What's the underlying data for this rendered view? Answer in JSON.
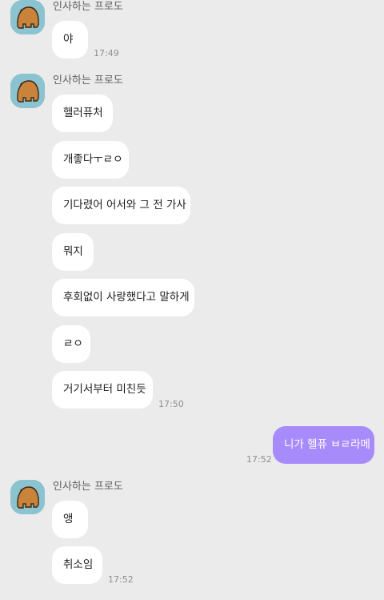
{
  "chat": {
    "groups": [
      {
        "sender": "인사하는 프로도",
        "messages": [
          {
            "text": "야",
            "time": "17:49"
          }
        ]
      },
      {
        "sender": "인사하는 프로도",
        "messages": [
          {
            "text": "헬러퓨처"
          },
          {
            "text": "개좋다ㅜㄹㅇ"
          },
          {
            "text": "기다렸어 어서와 그 전 가사"
          },
          {
            "text": "뭐지"
          },
          {
            "text": "후회없이 사랑했다고 말하게"
          },
          {
            "text": "ㄹㅇ"
          },
          {
            "text": "거기서부터 미친듯",
            "time": "17:50"
          }
        ]
      },
      {
        "sender": "",
        "outgoing": true,
        "messages": [
          {
            "text": "니가 헬퓨 ㅂㄹ라메",
            "time": "17:52"
          }
        ]
      },
      {
        "sender": "인사하는 프로도",
        "messages": [
          {
            "text": "앵"
          },
          {
            "text": "취소임",
            "time": "17:52"
          }
        ]
      }
    ]
  },
  "colors": {
    "background": "#ebebeb",
    "bubble_in": "#ffffff",
    "bubble_out": "#a78bfa",
    "avatar_bg": "#8cc3d0"
  },
  "icons": {
    "avatar": "bear-avatar-icon"
  }
}
